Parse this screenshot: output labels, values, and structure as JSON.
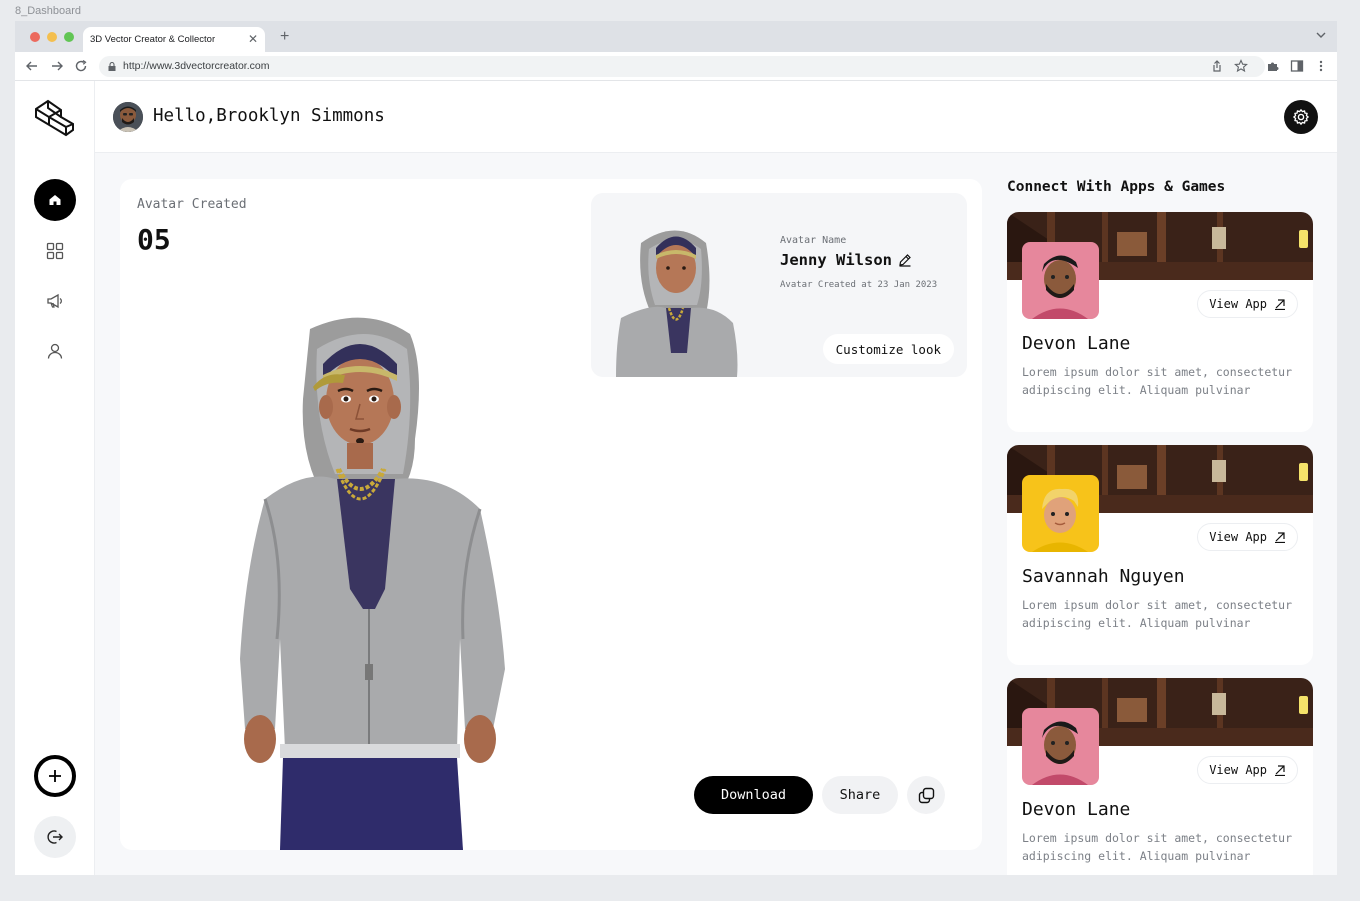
{
  "frame_label": "8_Dashboard",
  "browser": {
    "tab_title": "3D Vector Creator & Collector",
    "url": "http://www.3dvectorcreator.com",
    "traffic_colors": [
      "#ec6a5e",
      "#f4bf4f",
      "#61c554"
    ]
  },
  "sidebar": {
    "items": [
      {
        "icon": "home-icon",
        "active": true
      },
      {
        "icon": "grid-icon",
        "active": false
      },
      {
        "icon": "megaphone-icon",
        "active": false
      },
      {
        "icon": "user-icon",
        "active": false
      }
    ],
    "bottom": [
      {
        "icon": "plus-icon"
      },
      {
        "icon": "logout-icon"
      }
    ]
  },
  "header": {
    "greeting": "Hello,Brooklyn Simmons",
    "settings_icon": "gear-icon"
  },
  "main": {
    "stat_label": "Avatar Created",
    "stat_value": "05",
    "avatar_card": {
      "label": "Avatar Name",
      "name": "Jenny Wilson",
      "created": "Avatar Created at 23 Jan 2023",
      "customize_label": "Customize look"
    },
    "actions": {
      "download_label": "Download",
      "share_label": "Share",
      "copy_icon": "copy-icon"
    }
  },
  "apps": {
    "title": "Connect With Apps & Games",
    "items": [
      {
        "name": "Devon Lane",
        "desc": "Lorem ipsum dolor sit amet, consectetur adipiscing elit. Aliquam pulvinar",
        "button": "View App",
        "thumb_color": "#e6879c"
      },
      {
        "name": "Savannah Nguyen",
        "desc": "Lorem ipsum dolor sit amet, consectetur adipiscing elit. Aliquam pulvinar",
        "button": "View App",
        "thumb_color": "#f7c31a"
      },
      {
        "name": "Devon Lane",
        "desc": "Lorem ipsum dolor sit amet, consectetur adipiscing elit. Aliquam pulvinar",
        "button": "View App",
        "thumb_color": "#e6879c"
      }
    ]
  }
}
